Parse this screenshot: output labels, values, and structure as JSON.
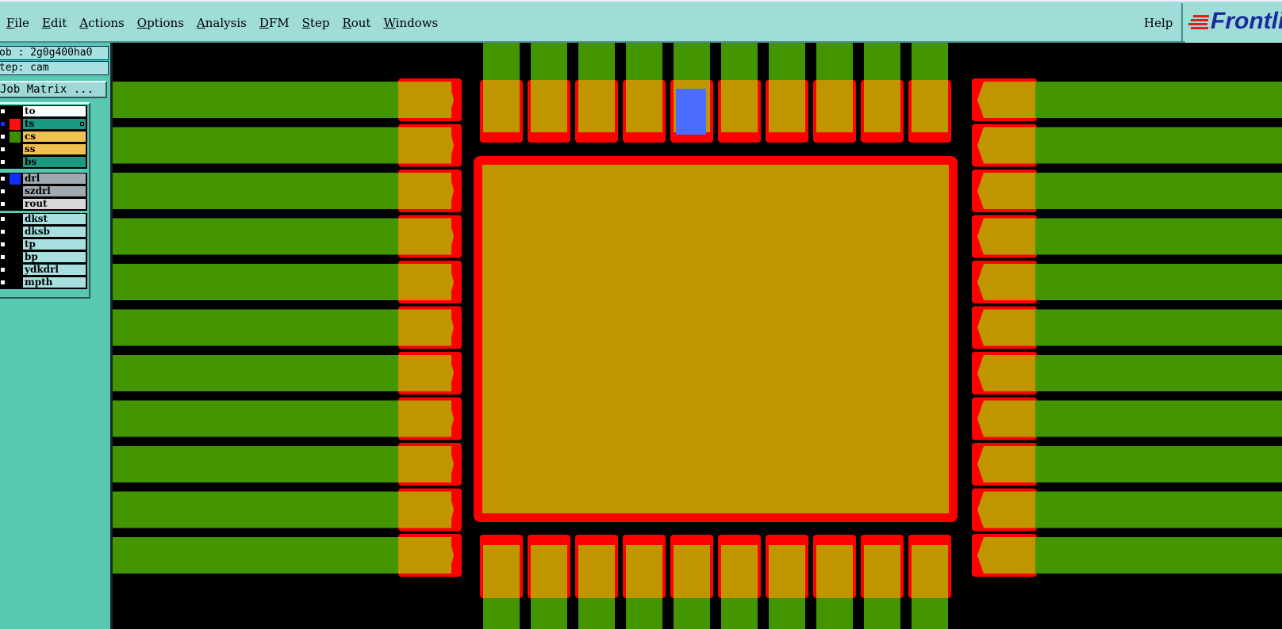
{
  "menubar": {
    "items": [
      "File",
      "Edit",
      "Actions",
      "Options",
      "Analysis",
      "DFM",
      "Step",
      "Rout",
      "Windows"
    ],
    "help": "Help",
    "logo": "Frontline"
  },
  "left_panel": {
    "job": "ob : 2g0g400ha0",
    "step": "tep: cam",
    "job_matrix_button": "Job Matrix ..."
  },
  "layers": {
    "group1": [
      {
        "name": "to",
        "color": "#ffffff",
        "swatch": "#000000"
      },
      {
        "name": "ts",
        "color": "#1a9a80",
        "swatch": "#ff1010",
        "active": true
      },
      {
        "name": "cs",
        "color": "#f0c050",
        "swatch": "#3c9000"
      },
      {
        "name": "ss",
        "color": "#f0c050",
        "swatch": "#000000"
      },
      {
        "name": "bs",
        "color": "#1a9a80",
        "swatch": "#000000"
      }
    ],
    "group2": [
      {
        "name": "drl",
        "color": "#a0a8b0",
        "swatch": "#1030ff"
      },
      {
        "name": "szdrl",
        "color": "#a0a8b0",
        "swatch": "#000000"
      },
      {
        "name": "rout",
        "color": "#d8d8d8",
        "swatch": "#000000"
      }
    ],
    "group3": [
      {
        "name": "dkst",
        "color": "#a8e0e0",
        "swatch": "#000000"
      },
      {
        "name": "dksb",
        "color": "#a8e0e0",
        "swatch": "#000000"
      },
      {
        "name": "tp",
        "color": "#a8e0e0",
        "swatch": "#000000"
      },
      {
        "name": "bp",
        "color": "#a8e0e0",
        "swatch": "#000000"
      },
      {
        "name": "ydkdrl",
        "color": "#a8e0e0",
        "swatch": "#000000"
      },
      {
        "name": "mpth",
        "color": "#a8e0e0",
        "swatch": "#000000"
      }
    ]
  },
  "colors": {
    "trace": "#439600",
    "pad": "#bf9600",
    "mask": "#ff0000",
    "drill": "#4a6cff",
    "background": "#000000"
  }
}
